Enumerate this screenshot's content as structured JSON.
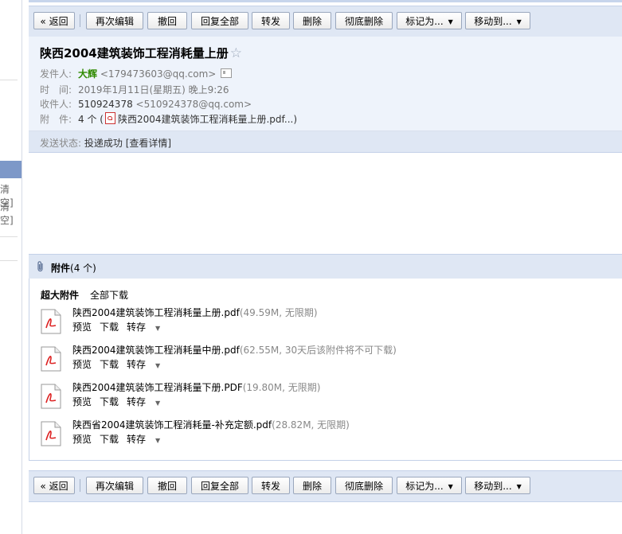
{
  "left_rail": {
    "clear1": "清空]",
    "clear2": "清空]"
  },
  "toolbar": {
    "back": "« 返回",
    "reedit": "再次编辑",
    "recall": "撤回",
    "reply_all": "回复全部",
    "forward": "转发",
    "delete": "删除",
    "delete_permanent": "彻底删除",
    "mark_as": "标记为...",
    "move_to": "移动到..."
  },
  "email": {
    "subject": "陕西2004建筑装饰工程消耗量上册",
    "from_label": "发件人:",
    "from_name": "大辉",
    "from_addr": "<179473603@qq.com>",
    "time_label": "时　间:",
    "time": "2019年1月11日(星期五) 晚上9:26",
    "to_label": "收件人:",
    "to_name": "510924378",
    "to_addr": "<510924378@qq.com>",
    "attach_label": "附　件:",
    "attach_summary_prefix": "4 个 (",
    "attach_summary_file": "陕西2004建筑装饰工程消耗量上册.pdf...)"
  },
  "status": {
    "label": "发送状态:",
    "value": "投递成功 [查看详情]"
  },
  "attachments": {
    "title": "附件",
    "count": "(4 个)",
    "big_label": "超大附件",
    "download_all": "全部下载",
    "preview_label": "预览",
    "download_label": "下载",
    "save_label": "转存",
    "files": [
      {
        "name": "陕西2004建筑装饰工程消耗量上册.pdf",
        "meta": "(49.59M, 无限期)"
      },
      {
        "name": "陕西2004建筑装饰工程消耗量中册.pdf",
        "meta": "(62.55M, 30天后该附件将不可下载)"
      },
      {
        "name": "陕西2004建筑装饰工程消耗量下册.PDF",
        "meta": "(19.80M, 无限期)"
      },
      {
        "name": "陕西省2004建筑装饰工程消耗量-补充定额.pdf",
        "meta": "(28.82M, 无限期)"
      }
    ]
  }
}
